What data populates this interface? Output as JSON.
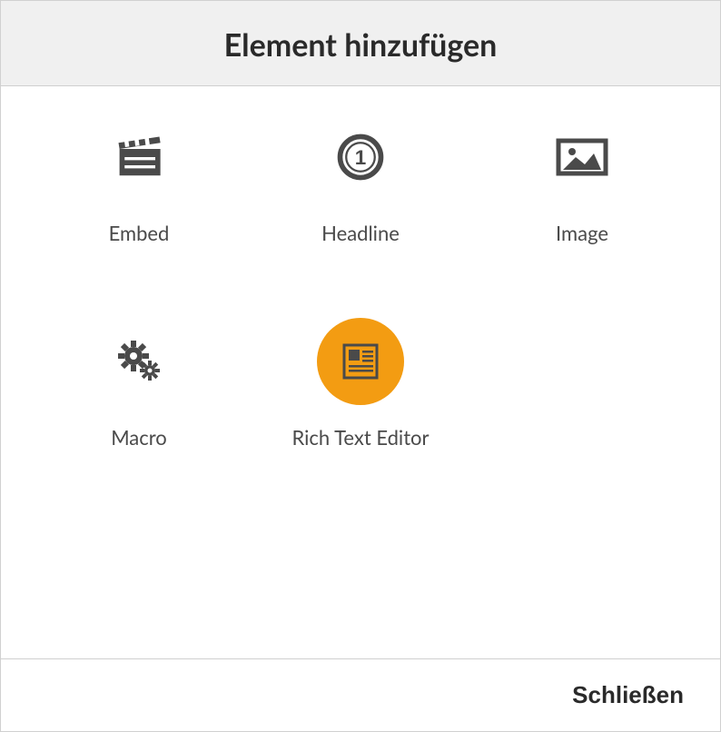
{
  "dialog": {
    "title": "Element hinzufügen",
    "close_label": "Schließen"
  },
  "elements": {
    "embed": {
      "label": "Embed",
      "icon": "clapperboard-icon",
      "highlight": false
    },
    "headline": {
      "label": "Headline",
      "icon": "circle-one-icon",
      "highlight": false
    },
    "image": {
      "label": "Image",
      "icon": "picture-icon",
      "highlight": false
    },
    "macro": {
      "label": "Macro",
      "icon": "gears-icon",
      "highlight": false
    },
    "rte": {
      "label": "Rich Text Editor",
      "icon": "newspaper-icon",
      "highlight": true
    }
  },
  "colors": {
    "icon": "#4a4a4a",
    "highlight_bg": "#f39c12"
  }
}
